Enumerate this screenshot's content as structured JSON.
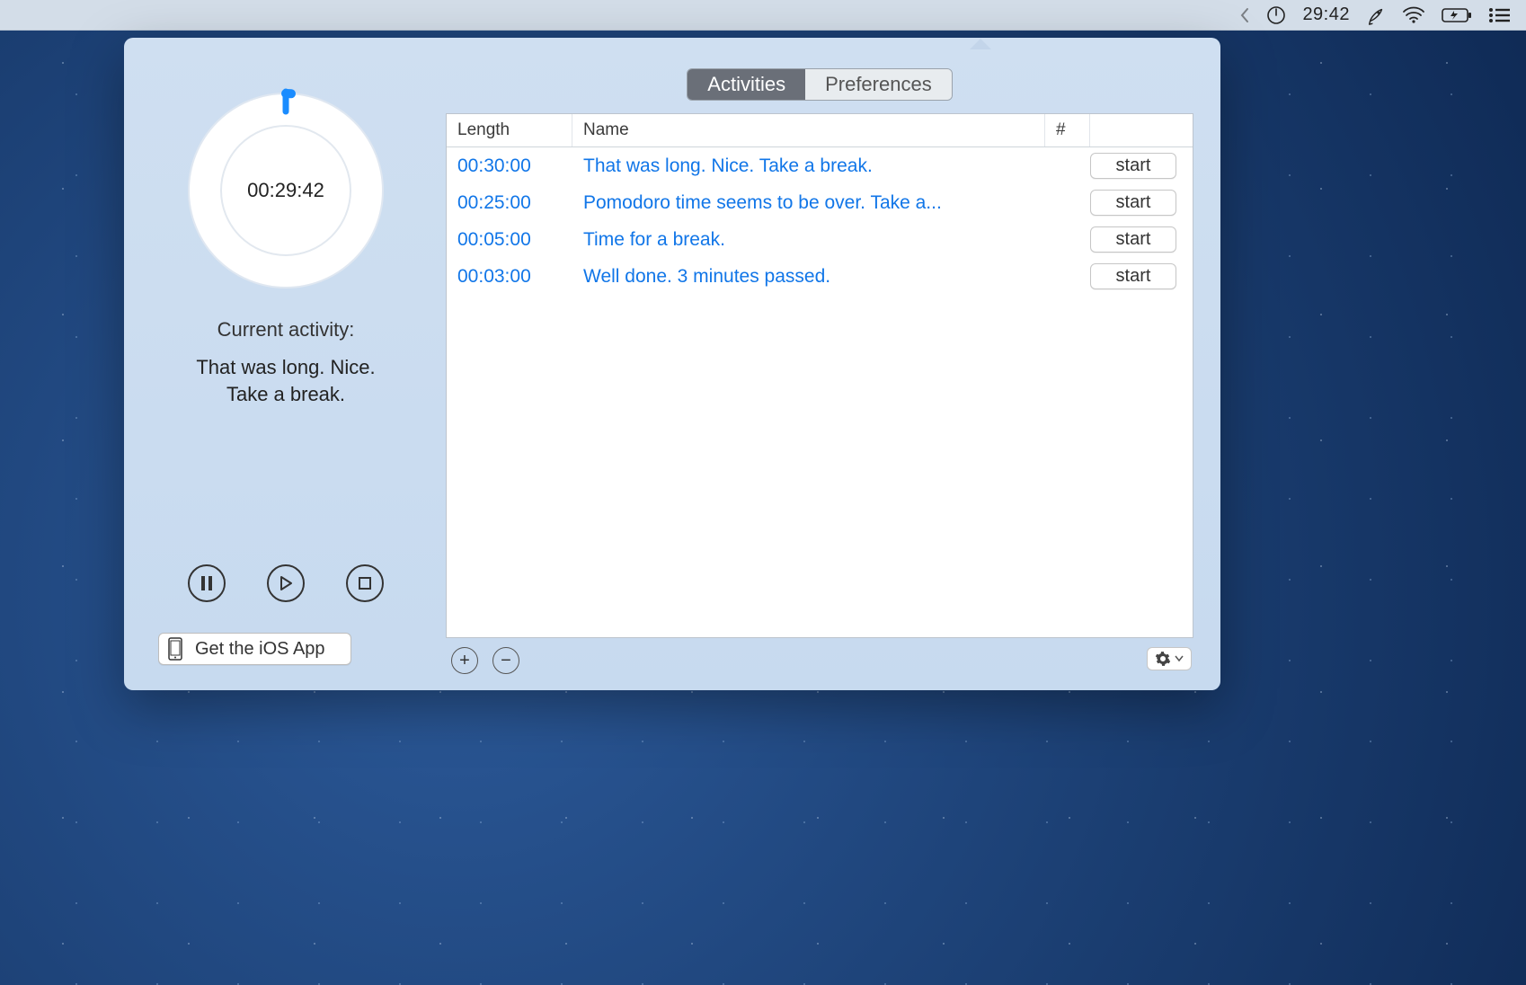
{
  "menubar": {
    "timer": "29:42"
  },
  "timer": {
    "time": "00:29:42",
    "current_label": "Current activity:",
    "current_text_line1": "That was long. Nice.",
    "current_text_line2": "Take a break."
  },
  "controls": {
    "ios_label": "Get the iOS App"
  },
  "tabs": {
    "activities": "Activities",
    "preferences": "Preferences"
  },
  "table": {
    "headers": {
      "length": "Length",
      "name": "Name",
      "hash": "#"
    },
    "start_label": "start",
    "rows": [
      {
        "length": "00:30:00",
        "name": "That was long. Nice. Take a break."
      },
      {
        "length": "00:25:00",
        "name": "Pomodoro time seems to be over. Take a..."
      },
      {
        "length": "00:05:00",
        "name": "Time for a break."
      },
      {
        "length": "00:03:00",
        "name": "Well done. 3 minutes passed."
      }
    ]
  },
  "buttons": {
    "plus": "+",
    "minus": "−"
  }
}
